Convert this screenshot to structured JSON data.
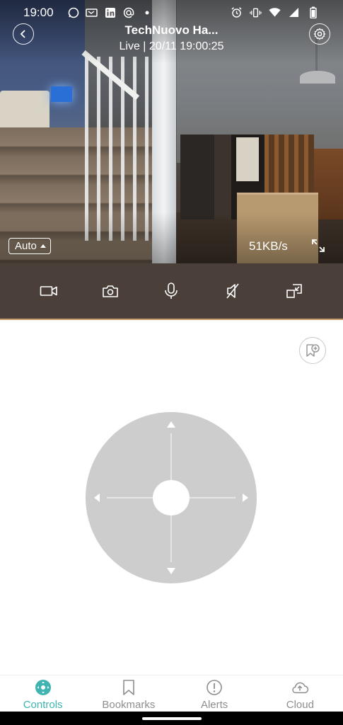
{
  "status_bar": {
    "time": "19:00"
  },
  "camera": {
    "title": "TechNuovo Ha...",
    "subtitle": "Live | 20/11 19:00:25",
    "quality": "Auto",
    "bitrate": "51KB/s"
  },
  "toolbar": {
    "items": [
      "record-video",
      "snapshot",
      "talk",
      "mute-speaker",
      "picture-in-picture"
    ]
  },
  "bottom_nav": {
    "items": [
      {
        "label": "Controls",
        "active": true
      },
      {
        "label": "Bookmarks",
        "active": false
      },
      {
        "label": "Alerts",
        "active": false
      },
      {
        "label": "Cloud",
        "active": false
      }
    ]
  },
  "colors": {
    "accent": "#3fb4b0",
    "toolbar_bg": "#4a4039",
    "toolbar_border": "#c79a6a",
    "joystick": "#cdcdcd"
  }
}
